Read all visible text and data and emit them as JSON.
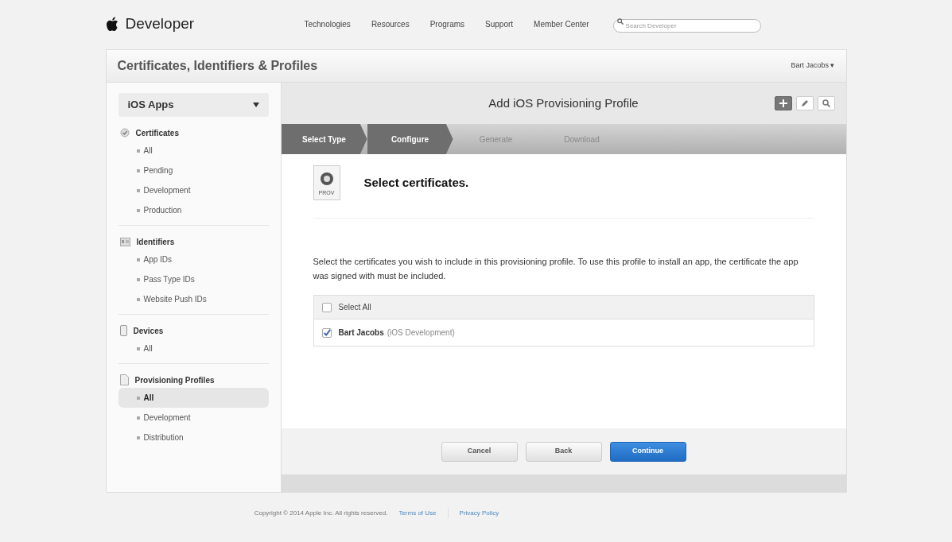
{
  "header": {
    "brand": "Developer",
    "nav": [
      "Technologies",
      "Resources",
      "Programs",
      "Support",
      "Member Center"
    ],
    "search": {
      "placeholder": "Search Developer"
    }
  },
  "subheader": {
    "title": "Certificates, Identifiers & Profiles",
    "user": "Bart Jacobs ▾"
  },
  "sidebar": {
    "platform": "iOS Apps",
    "sections": [
      {
        "kind": "certificate",
        "title": "Certificates",
        "items": [
          {
            "label": "All",
            "selected": false
          },
          {
            "label": "Pending",
            "selected": false
          },
          {
            "label": "Development",
            "selected": false
          },
          {
            "label": "Production",
            "selected": false
          }
        ]
      },
      {
        "kind": "identifier",
        "title": "Identifiers",
        "items": [
          {
            "label": "App IDs",
            "selected": false
          },
          {
            "label": "Pass Type IDs",
            "selected": false
          },
          {
            "label": "Website Push IDs",
            "selected": false
          }
        ]
      },
      {
        "kind": "device",
        "title": "Devices",
        "items": [
          {
            "label": "All",
            "selected": false
          }
        ]
      },
      {
        "kind": "profile",
        "title": "Provisioning Profiles",
        "items": [
          {
            "label": "All",
            "selected": true
          },
          {
            "label": "Development",
            "selected": false
          },
          {
            "label": "Distribution",
            "selected": false
          }
        ]
      }
    ]
  },
  "main": {
    "title": "Add iOS Provisioning Profile",
    "toolbar": [
      {
        "kind": "add",
        "selected": true
      },
      {
        "kind": "edit",
        "selected": false
      },
      {
        "kind": "search",
        "selected": false
      }
    ],
    "steps": [
      {
        "label": "Select Type",
        "active": true
      },
      {
        "label": "Configure",
        "active": true
      },
      {
        "label": "Generate",
        "active": false
      },
      {
        "label": "Download",
        "active": false
      }
    ],
    "file_icon_label": "PROV",
    "heading": "Select certificates.",
    "description": "Select the certificates you wish to include in this provisioning profile. To use this profile to install an app, the certificate the app was signed with must be included.",
    "select_all": {
      "label": "Select All",
      "checked": false
    },
    "certificates": [
      {
        "name": "Bart Jacobs",
        "type": "(iOS Development)",
        "checked": true
      }
    ],
    "buttons": [
      {
        "label": "Cancel",
        "kind": "secondary"
      },
      {
        "label": "Back",
        "kind": "secondary"
      },
      {
        "label": "Continue",
        "kind": "primary"
      }
    ]
  },
  "footer": {
    "copyright": "Copyright © 2014 Apple Inc. All rights reserved.",
    "links": [
      "Terms of Use",
      "Privacy Policy"
    ]
  }
}
